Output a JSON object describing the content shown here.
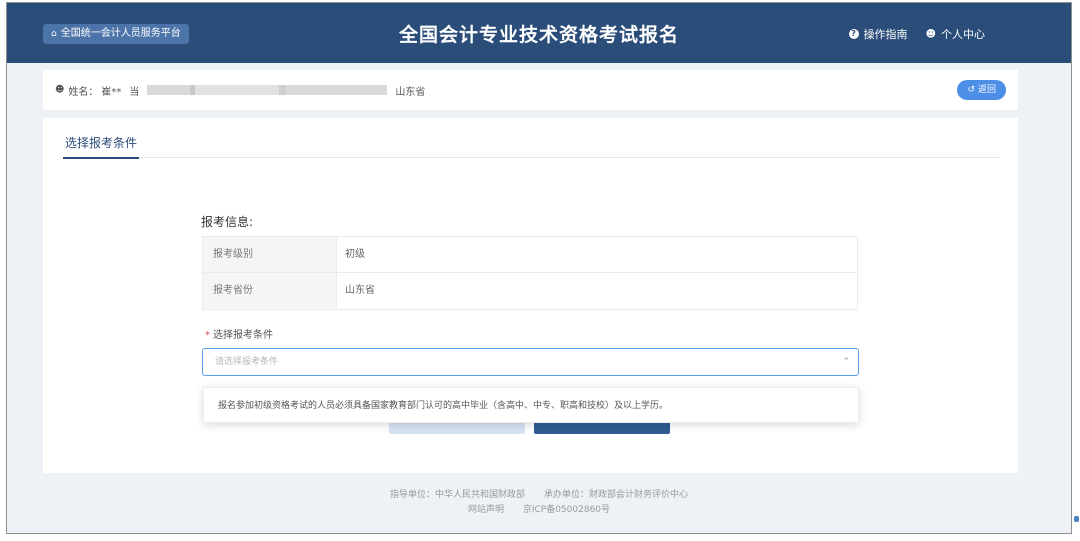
{
  "header": {
    "portal_button": "全国统一会计人员服务平台",
    "title": "全国会计专业技术资格考试报名",
    "guide_link": "操作指南",
    "user_center_link": "个人中心"
  },
  "user_bar": {
    "name_label": "姓名：",
    "name_value": "崔**",
    "id_prefix": "当",
    "province": "山东省",
    "back_button": "返回"
  },
  "tabs": {
    "active_tab": "选择报考条件"
  },
  "exam_info": {
    "section_title": "报考信息:",
    "rows": [
      {
        "label": "报考级别",
        "value": "初级"
      },
      {
        "label": "报考省份",
        "value": "山东省"
      }
    ]
  },
  "condition": {
    "label": "选择报考条件",
    "required_mark": "*",
    "placeholder": "请选择报考条件",
    "option": "报名参加初级资格考试的人员必须具备国家教育部门认可的高中毕业（含高中、中专、职高和技校）及以上学历。"
  },
  "footer": {
    "guide_unit": "指导单位：中华人民共和国财政部",
    "host_unit": "承办单位：财政部会计财务评价中心",
    "statement": "网站声明",
    "icp": "京ICP备05002860号"
  },
  "colors": {
    "header_bg": "#2b4d7a",
    "accent": "#4d8ee6",
    "primary_button": "#2f5c94"
  }
}
